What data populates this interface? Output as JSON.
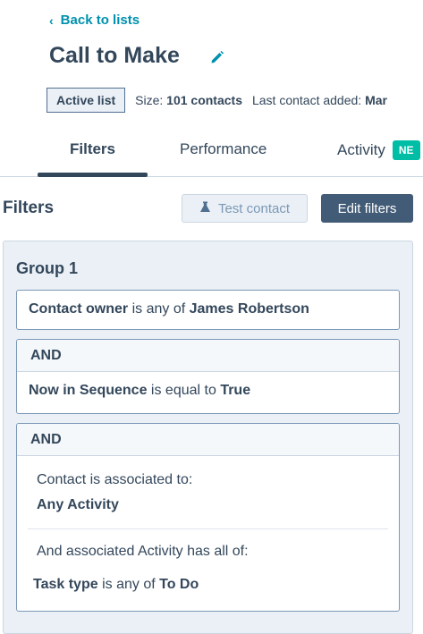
{
  "nav": {
    "back_label": "Back to lists"
  },
  "header": {
    "title": "Call to Make",
    "status_badge": "Active list",
    "size_label": "Size:",
    "size_value": "101 contacts",
    "last_added_label": "Last contact added:",
    "last_added_value": "Mar"
  },
  "tabs": {
    "filters": "Filters",
    "performance": "Performance",
    "activity": "Activity",
    "activity_badge": "NE"
  },
  "filters_section": {
    "title": "Filters",
    "test_contact_label": "Test contact",
    "edit_filters_label": "Edit filters"
  },
  "group": {
    "title": "Group 1",
    "filter1": {
      "property": "Contact owner",
      "operator": "is any of",
      "value": "James Robertson"
    },
    "filter2": {
      "connector": "AND",
      "property": "Now in Sequence",
      "operator": "is equal to",
      "value": "True"
    },
    "filter3": {
      "connector": "AND",
      "assoc_label": "Contact is associated to:",
      "assoc_value": "Any Activity",
      "sub_label": "And associated Activity has all of:",
      "property": "Task type",
      "operator": "is any of",
      "value": "To Do"
    }
  },
  "colors": {
    "link": "#0091ae",
    "text": "#33475b",
    "primary_button": "#425b76",
    "new_badge": "#00bda5",
    "group_bg": "#eaf0f6"
  },
  "icons": {
    "back": "chevron-left-icon",
    "edit": "pencil-icon",
    "test": "flask-icon"
  }
}
